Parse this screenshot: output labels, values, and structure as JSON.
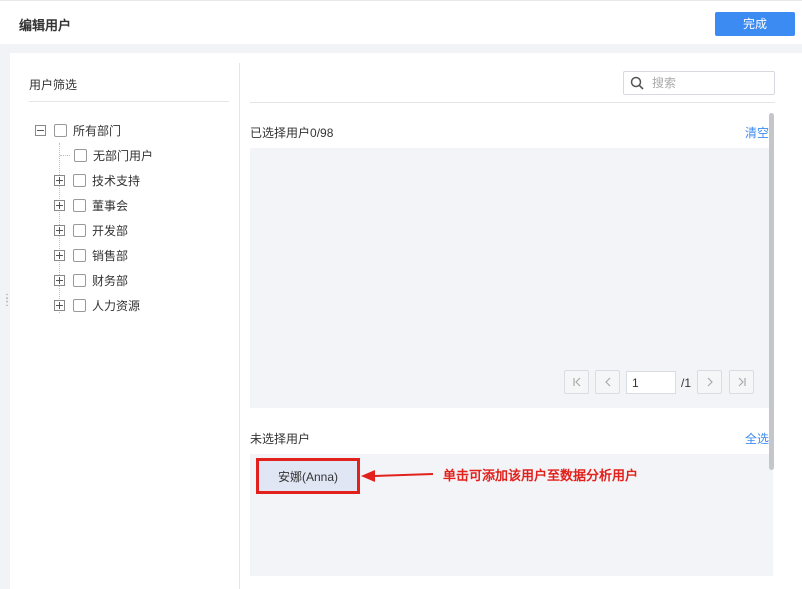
{
  "header": {
    "title": "编辑用户",
    "done_label": "完成"
  },
  "filter": {
    "title": "用户筛选",
    "tree": [
      {
        "label": "所有部门",
        "level": 0,
        "expander": "minus"
      },
      {
        "label": "无部门用户",
        "level": 1,
        "expander": "none"
      },
      {
        "label": "技术支持",
        "level": 1,
        "expander": "plus"
      },
      {
        "label": "董事会",
        "level": 1,
        "expander": "plus"
      },
      {
        "label": "开发部",
        "level": 1,
        "expander": "plus"
      },
      {
        "label": "销售部",
        "level": 1,
        "expander": "plus"
      },
      {
        "label": "财务部",
        "level": 1,
        "expander": "plus"
      },
      {
        "label": "人力资源",
        "level": 1,
        "expander": "plus"
      }
    ]
  },
  "search": {
    "placeholder": "搜索",
    "value": ""
  },
  "selected": {
    "label": "已选择用户",
    "count": "0/98",
    "clear_label": "清空"
  },
  "pagination": {
    "current_page": "1",
    "total": "/1"
  },
  "unselected": {
    "label": "未选择用户",
    "select_all_label": "全选",
    "users": [
      "安娜(Anna)"
    ]
  },
  "annotation": {
    "text": "单击可添加该用户至数据分析用户",
    "color": "#e2211c"
  },
  "colors": {
    "accent": "#3c8bf2",
    "highlight": "#e2211c"
  }
}
